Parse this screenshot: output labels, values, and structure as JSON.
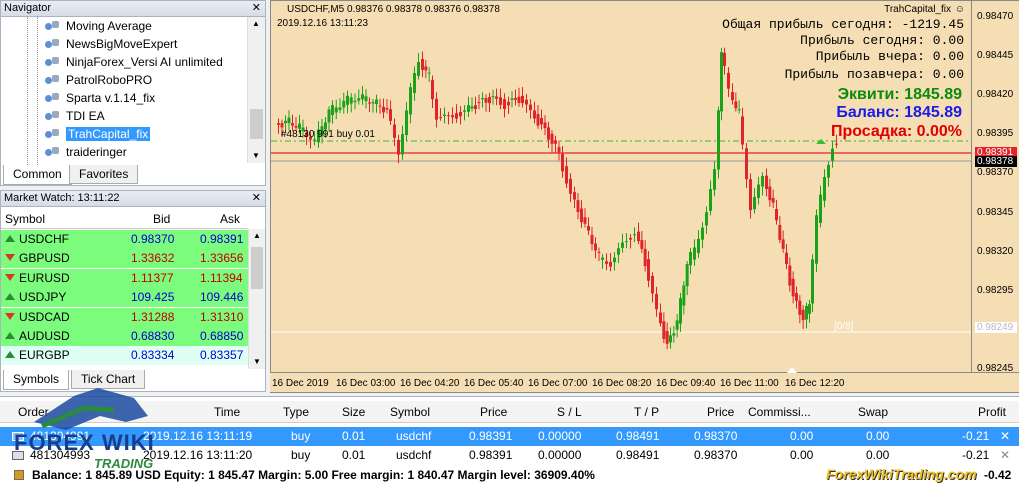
{
  "navigator": {
    "title": "Navigator",
    "items": [
      "Moving Average",
      "NewsBigMoveExpert",
      "NinjaForex_Versi AI unlimited",
      "PatrolRoboPRO",
      "Sparta v.1.14_fix",
      "TDI EA",
      "TrahCapital_fix",
      "traideringer"
    ],
    "tabs": [
      "Common",
      "Favorites"
    ]
  },
  "market_watch": {
    "title": "Market Watch: 13:11:22",
    "columns": [
      "Symbol",
      "Bid",
      "Ask"
    ],
    "rows": [
      {
        "symbol": "USDCHF",
        "bid": "0.98370",
        "ask": "0.98391",
        "dir": "up"
      },
      {
        "symbol": "GBPUSD",
        "bid": "1.33632",
        "ask": "1.33656",
        "dir": "down"
      },
      {
        "symbol": "EURUSD",
        "bid": "1.11377",
        "ask": "1.11394",
        "dir": "down"
      },
      {
        "symbol": "USDJPY",
        "bid": "109.425",
        "ask": "109.446",
        "dir": "up"
      },
      {
        "symbol": "USDCAD",
        "bid": "1.31288",
        "ask": "1.31310",
        "dir": "down"
      },
      {
        "symbol": "AUDUSD",
        "bid": "0.68830",
        "ask": "0.68850",
        "dir": "up"
      },
      {
        "symbol": "EURGBP",
        "bid": "0.83334",
        "ask": "0.83357",
        "dir": "up"
      }
    ],
    "tabs": [
      "Symbols",
      "Tick Chart"
    ]
  },
  "chart": {
    "header": "USDCHF,M5  0.98376 0.98378 0.98376 0.98378",
    "datetime": "2019.12.16 13:11:23",
    "ea_name": "TrahCapital_fix",
    "profit_today_total": "Общая прибыль сегодня: -1219.45",
    "profit_today": "Прибыль сегодня: 0.00",
    "profit_yesterday": "Прибыль вчера: 0.00",
    "profit_day_before": "Прибыль позавчера: 0.00",
    "equity": "Эквити: 1845.89",
    "balance": "Баланс: 1845.89",
    "drawdown": "Просадка: 0.00%",
    "order_line_label": "#48130 991 buy 0.01",
    "price_ticks": [
      "0.98470",
      "0.98445",
      "0.98420",
      "0.98395",
      "0.98370",
      "0.98345",
      "0.98320",
      "0.98295",
      "0.98270",
      "0.98245"
    ],
    "price_tag_red": "0.98391",
    "price_tag_black": "0.98378",
    "price_tag_low": "0.98249",
    "counter": "[0/8]",
    "time_ticks": [
      "16 Dec 2019",
      "16 Dec 03:00",
      "16 Dec 04:20",
      "16 Dec 05:40",
      "16 Dec 07:00",
      "16 Dec 08:20",
      "16 Dec 09:40",
      "16 Dec 11:00",
      "16 Dec 12:20"
    ],
    "colors": {
      "background": "#f5deb3",
      "bull": "#1aa31a",
      "bear": "#e0252a",
      "equity": "#0b8a0b",
      "balance": "#1a1ae6",
      "drawdown": "#e00000"
    }
  },
  "trade": {
    "columns": [
      "Order",
      "Time",
      "Type",
      "Size",
      "Symbol",
      "Price",
      "S / L",
      "T / P",
      "Price",
      "Commissi...",
      "Swap",
      "Profit"
    ],
    "rows": [
      {
        "order": "481304991",
        "time": "2019.12.16 13:11:19",
        "type": "buy",
        "size": "0.01",
        "symbol": "usdchf",
        "price": "0.98391",
        "sl": "0.00000",
        "tp": "0.98491",
        "cur": "0.98370",
        "comm": "0.00",
        "swap": "0.00",
        "profit": "-0.21"
      },
      {
        "order": "481304993",
        "time": "2019.12.16 13:11:20",
        "type": "buy",
        "size": "0.01",
        "symbol": "usdchf",
        "price": "0.98391",
        "sl": "0.00000",
        "tp": "0.98491",
        "cur": "0.98370",
        "comm": "0.00",
        "swap": "0.00",
        "profit": "-0.21"
      }
    ],
    "status": "Balance: 1 845.89 USD  Equity: 1 845.47  Margin: 5.00  Free margin: 1 840.47  Margin level: 36909.40%",
    "total_profit": "-0.42"
  },
  "watermark": {
    "logo_top": "FOREX WIKI",
    "logo_bottom": "TRADING",
    "site": "ForexWikiTrading.com"
  }
}
